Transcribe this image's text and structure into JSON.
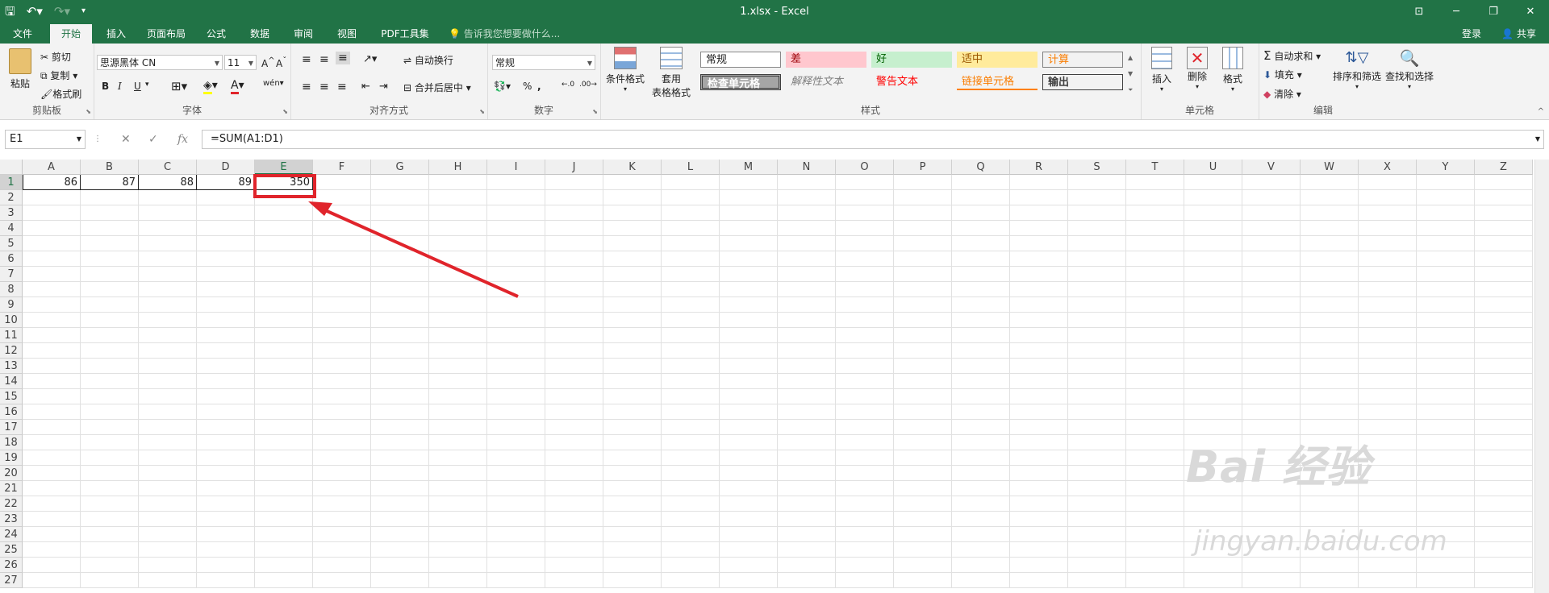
{
  "window": {
    "title": "1.xlsx - Excel",
    "login": "登录",
    "share": "共享"
  },
  "tabs": [
    "文件",
    "开始",
    "插入",
    "页面布局",
    "公式",
    "数据",
    "审阅",
    "视图",
    "PDF工具集"
  ],
  "tellme": "告诉我您想要做什么...",
  "ribbon": {
    "clipboard": {
      "paste": "粘贴",
      "cut": "剪切",
      "copy": "复制",
      "format_painter": "格式刷",
      "label": "剪贴板"
    },
    "font": {
      "name": "思源黑体 CN",
      "size": "11",
      "label": "字体",
      "bold": "B",
      "italic": "I",
      "underline": "U"
    },
    "alignment": {
      "wrap": "自动换行",
      "merge": "合并后居中",
      "label": "对齐方式"
    },
    "number": {
      "format": "常规",
      "label": "数字",
      "percent": "%",
      "comma": ","
    },
    "styles": {
      "conditional": "条件格式",
      "table_format_1": "套用",
      "table_format_2": "表格格式",
      "cells": [
        "常规",
        "差",
        "好",
        "适中",
        "计算",
        "检查单元格",
        "解释性文本",
        "警告文本",
        "链接单元格",
        "输出"
      ],
      "label": "样式"
    },
    "cells_group": {
      "insert": "插入",
      "delete": "删除",
      "format": "格式",
      "label": "单元格"
    },
    "editing": {
      "autosum": "自动求和",
      "fill": "填充",
      "clear": "清除",
      "sort": "排序和筛选",
      "find": "查找和选择",
      "label": "编辑"
    }
  },
  "formula_bar": {
    "name_box": "E1",
    "fx": "fx",
    "formula": "=SUM(A1:D1)"
  },
  "sheet": {
    "columns": [
      "A",
      "B",
      "C",
      "D",
      "E",
      "F",
      "G",
      "H",
      "I",
      "J",
      "K",
      "L",
      "M",
      "N",
      "O",
      "P",
      "Q",
      "R",
      "S",
      "T",
      "U",
      "V",
      "W",
      "X",
      "Y",
      "Z"
    ],
    "rows": [
      "1",
      "2",
      "3",
      "4",
      "5",
      "6",
      "7",
      "8",
      "9",
      "10",
      "11",
      "12",
      "13",
      "14",
      "15",
      "16",
      "17",
      "18",
      "19",
      "20",
      "21",
      "22",
      "23",
      "24",
      "25",
      "26",
      "27"
    ],
    "row1": [
      "86",
      "87",
      "88",
      "89",
      "350"
    ],
    "selected": "E1"
  },
  "watermark": {
    "text": "Bai 经验",
    "url": "jingyan.baidu.com"
  },
  "colors": {
    "accent": "#217346",
    "highlight": "#e0242b"
  }
}
